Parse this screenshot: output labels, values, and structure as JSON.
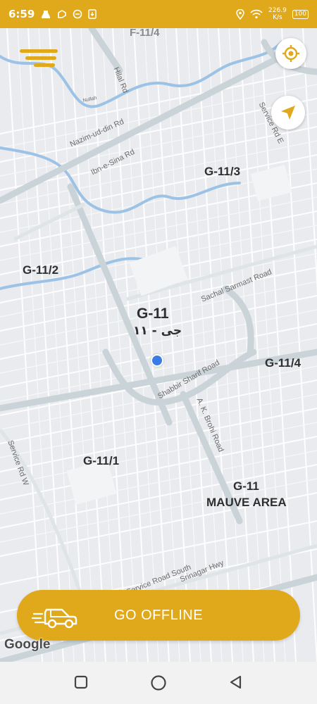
{
  "status_bar": {
    "time": "6:59",
    "network_speed": "226.9",
    "speed_unit": "K/s",
    "battery": "100",
    "icons": [
      "notification-icon",
      "app-icon",
      "sync-icon",
      "download-icon",
      "location-icon",
      "wifi-icon"
    ]
  },
  "map": {
    "area_labels": {
      "f11_4": "F-11/4",
      "g11_3": "G-11/3",
      "g11_2": "G-11/2",
      "g11": "G-11",
      "g11_urdu": "جی - ۱۱",
      "g11_4": "G-11/4",
      "g11_1": "G-11/1",
      "mauve_1": "G-11",
      "mauve_2": "MAUVE AREA"
    },
    "road_labels": {
      "hilal": "Hilal Rd",
      "nazim": "Nazim-ud-din Rd",
      "ibn": "Ibn-e-Sina Rd",
      "service_e": "Service Rd E",
      "sachal": "Sachal Sarmast Road",
      "shabbir": "Shabbir Sharif Road",
      "brohi": "A. K. Brohi Road",
      "service_w": "Service Rd W",
      "service_s": "Service Road South",
      "srinagar": "Srinagar Hwy",
      "stream": "Nullah"
    },
    "controls": {
      "menu_icon": "hamburger-menu-icon",
      "locate_icon": "gps-target-icon",
      "navigate_icon": "navigation-arrow-icon"
    }
  },
  "bottom": {
    "go_offline_label": "GO OFFLINE",
    "car_icon": "car-icon",
    "google": "Google"
  },
  "colors": {
    "accent": "#e0a91c",
    "water": "#9cc3e6",
    "location": "#3b7be6"
  }
}
